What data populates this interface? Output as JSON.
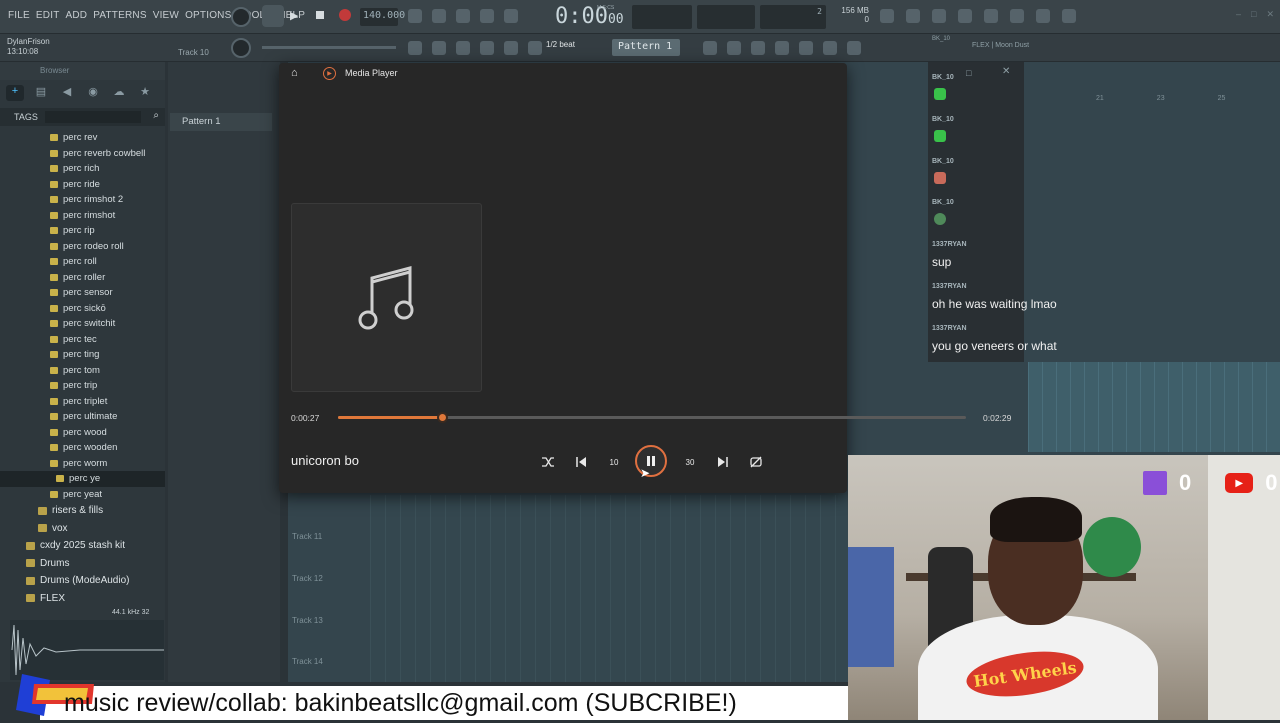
{
  "daw": {
    "menu": [
      "FILE",
      "EDIT",
      "ADD",
      "PATTERNS",
      "VIEW",
      "OPTIONS",
      "TOOLS",
      "HELP"
    ],
    "user": "DylanFrison",
    "session_time": "13:10:08",
    "hint_track": "Track 10",
    "tempo": "140.000",
    "time_display": "0:00",
    "time_frac": "00",
    "time_unit": "M:S:CS",
    "cpu_count": "2",
    "memory": "156 MB",
    "memory_sub": "0",
    "snap": "1/2 beat",
    "pattern_selector": "Pattern 1",
    "plugin_title": "FLEX | Moon Dust",
    "channel_name": "BK_10"
  },
  "browser": {
    "title": "Browser",
    "tags_label": "TAGS",
    "items": [
      "perc rev",
      "perc reverb cowbell",
      "perc rich",
      "perc ride",
      "perc rimshot 2",
      "perc rimshot",
      "perc rip",
      "perc rodeo roll",
      "perc roll",
      "perc roller",
      "perc sensor",
      "perc sickō",
      "perc switchit",
      "perc tec",
      "perc ting",
      "perc tom",
      "perc trip",
      "perc triplet",
      "perc ultimate",
      "perc wood",
      "perc wooden",
      "perc worm",
      "perc ye",
      "perc yeat"
    ],
    "folders": [
      "risers & fills",
      "vox",
      "cxdy 2025 stash kit",
      "Drums",
      "Drums (ModeAudio)",
      "FLEX"
    ],
    "sample_info": "44.1 kHz 32"
  },
  "pattern_panel": {
    "pattern": "Pattern 1"
  },
  "playlist": {
    "tracks": [
      "Track 11",
      "Track 12",
      "Track 13",
      "Track 14"
    ],
    "ruler_marks": [
      "21",
      "23",
      "25"
    ]
  },
  "player": {
    "title": "Media Player",
    "elapsed": "0:00:27",
    "total": "0:02:29",
    "progress": 0.166,
    "song": "unicoron bo",
    "rewind_label": "10",
    "forward_label": "30",
    "accent": "#e0783a"
  },
  "chat": [
    {
      "user": "BK_10",
      "msg": "",
      "emote": "#39c24a"
    },
    {
      "user": "BK_10",
      "msg": "",
      "emote": "#39c24a"
    },
    {
      "user": "BK_10",
      "msg": "",
      "emote": "#c86a5a"
    },
    {
      "user": "BK_10",
      "msg": "",
      "emote": "#4f8a5a"
    },
    {
      "user": "1337RYAN",
      "msg": "sup"
    },
    {
      "user": "1337RYAN",
      "msg": "oh he was waiting lmao"
    },
    {
      "user": "1337RYAN",
      "msg": "you go veneers or what"
    }
  ],
  "social": {
    "twitch_count": "0",
    "youtube_count": "0"
  },
  "cam": {
    "shirt_logo": "Hot Wheels"
  },
  "banner": {
    "text": "music review/collab: bakinbeatsllc@gmail.com (SUBCRIBE!)"
  }
}
